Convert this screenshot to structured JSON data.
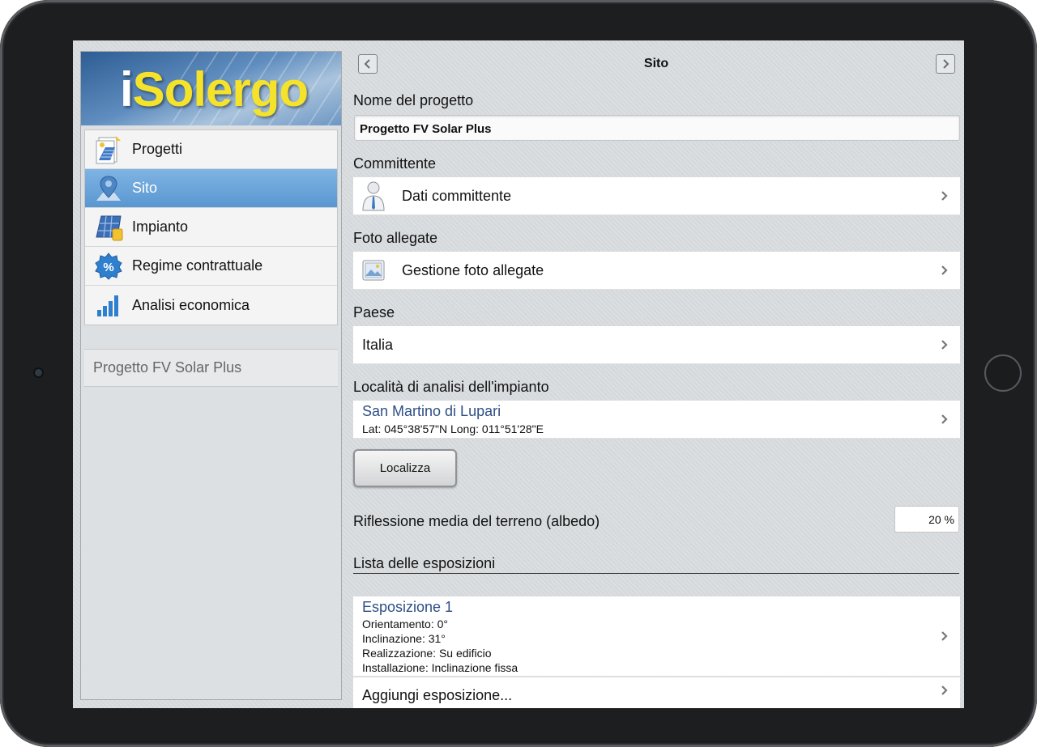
{
  "app": {
    "logo_text_i": "i",
    "logo_text_rest": "Solergo"
  },
  "sidebar": {
    "items": [
      {
        "label": "Progetti",
        "icon": "projects-icon",
        "active": false
      },
      {
        "label": "Sito",
        "icon": "location-pin-icon",
        "active": true
      },
      {
        "label": "Impianto",
        "icon": "solar-panel-icon",
        "active": false
      },
      {
        "label": "Regime contrattuale",
        "icon": "percent-badge-icon",
        "active": false
      },
      {
        "label": "Analisi economica",
        "icon": "bar-chart-icon",
        "active": false
      }
    ],
    "current_project": "Progetto FV Solar Plus"
  },
  "header": {
    "title": "Sito"
  },
  "form": {
    "project_name_label": "Nome del progetto",
    "project_name_value": "Progetto FV Solar Plus",
    "client_label": "Committente",
    "client_cell": "Dati committente",
    "photos_label": "Foto allegate",
    "photos_cell": "Gestione foto allegate",
    "country_label": "Paese",
    "country_value": "Italia",
    "location_label": "Località di analisi dell'impianto",
    "location_name": "San Martino di Lupari",
    "location_coords": "Lat: 045°38'57\"N Long: 011°51'28\"E",
    "locate_button": "Localizza",
    "albedo_label": "Riflessione media del terreno (albedo)",
    "albedo_value": "20 %",
    "exposures_label": "Lista delle esposizioni",
    "exposures": [
      {
        "title": "Esposizione 1",
        "orientamento": "Orientamento: 0°",
        "inclinazione": "Inclinazione: 31°",
        "realizzazione": "Realizzazione: Su edificio",
        "installazione": "Installazione: Inclinazione fissa"
      }
    ],
    "add_exposure": "Aggiungi esposizione..."
  },
  "colors": {
    "accent_active": "#5997d1",
    "link_blue": "#2f4f86",
    "logo_yellow": "#f4e32a"
  }
}
